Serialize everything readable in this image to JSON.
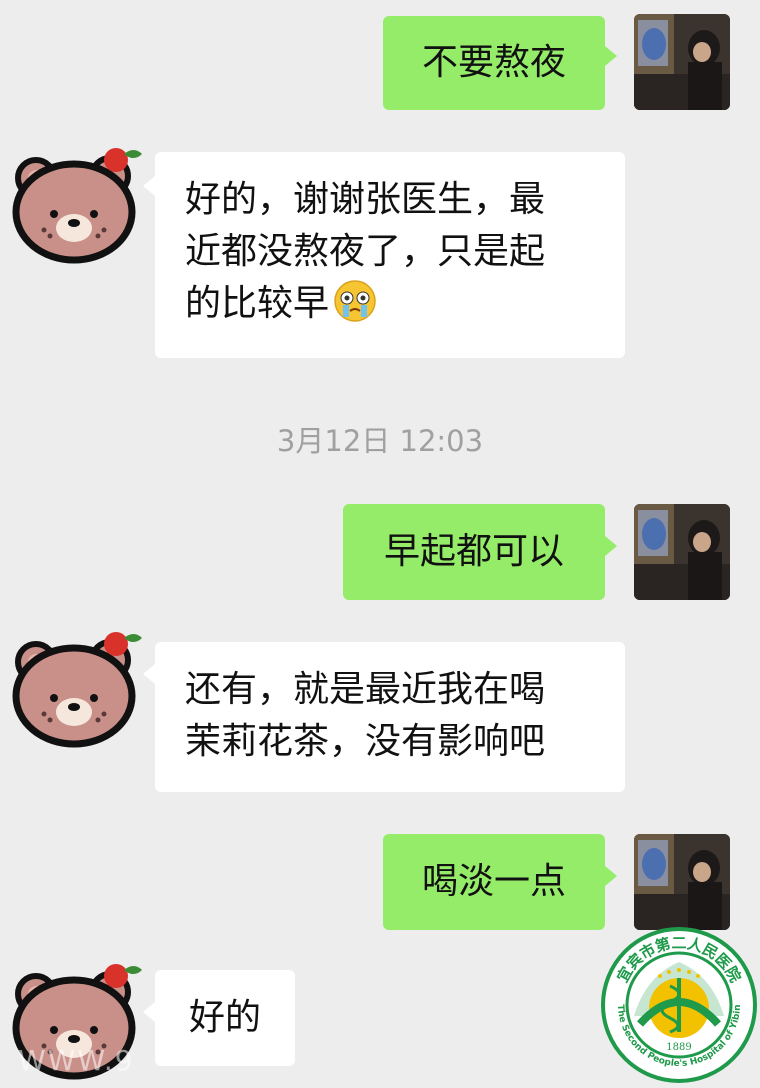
{
  "messages": [
    {
      "id": "m1",
      "direction": "outgoing",
      "text": "不要熬夜"
    },
    {
      "id": "m2",
      "direction": "incoming",
      "lines": [
        "好的，谢谢张医生，最",
        "近都没熬夜了，只是起",
        "的比较早"
      ],
      "emoji": "crying-face"
    },
    {
      "id": "m3",
      "direction": "outgoing",
      "text": "早起都可以"
    },
    {
      "id": "m4",
      "direction": "incoming",
      "lines": [
        "还有，就是最近我在喝",
        "茉莉花茶，没有影响吧"
      ]
    },
    {
      "id": "m5",
      "direction": "outgoing",
      "text": "喝淡一点"
    },
    {
      "id": "m6",
      "direction": "incoming",
      "text": "好的"
    }
  ],
  "timestamp": "3月12日 12:03",
  "watermark": "WWW.9",
  "seal": {
    "text_cn": "宜宾市第二人民医院",
    "text_en": "The Second People's Hospital of Yibin",
    "year": "1889"
  },
  "colors": {
    "background": "#ededed",
    "outgoing_bubble": "#95ec69",
    "incoming_bubble": "#ffffff",
    "seal_green": "#1e9a4a",
    "seal_yellow": "#f2c200"
  },
  "icons": {
    "self_avatar": "photo-avatar-icon",
    "contact_avatar": "bear-avatar-icon",
    "emoji": "crying-face-icon",
    "seal": "hospital-seal-icon"
  }
}
